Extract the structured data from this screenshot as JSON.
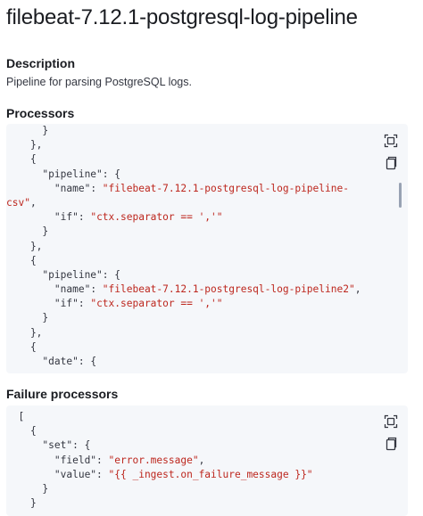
{
  "page": {
    "title": "filebeat-7.12.1-postgresql-log-pipeline"
  },
  "description": {
    "heading": "Description",
    "text": "Pipeline for parsing PostgreSQL logs."
  },
  "processors": {
    "heading": "Processors",
    "lines": [
      [
        {
          "t": "p",
          "v": "      }"
        }
      ],
      [
        {
          "t": "p",
          "v": "    },"
        }
      ],
      [
        {
          "t": "p",
          "v": "    {"
        }
      ],
      [
        {
          "t": "p",
          "v": "      "
        },
        {
          "t": "k",
          "v": "\"pipeline\""
        },
        {
          "t": "p",
          "v": ": {"
        }
      ],
      [
        {
          "t": "p",
          "v": "        "
        },
        {
          "t": "k",
          "v": "\"name\""
        },
        {
          "t": "p",
          "v": ": "
        },
        {
          "t": "s",
          "v": "\"filebeat-7.12.1-postgresql-log-pipeline-"
        }
      ],
      [
        {
          "t": "s",
          "v": "csv\""
        },
        {
          "t": "p",
          "v": ","
        }
      ],
      [
        {
          "t": "p",
          "v": "        "
        },
        {
          "t": "k",
          "v": "\"if\""
        },
        {
          "t": "p",
          "v": ": "
        },
        {
          "t": "s",
          "v": "\"ctx.separator == ','\""
        }
      ],
      [
        {
          "t": "p",
          "v": "      }"
        }
      ],
      [
        {
          "t": "p",
          "v": "    },"
        }
      ],
      [
        {
          "t": "p",
          "v": "    {"
        }
      ],
      [
        {
          "t": "p",
          "v": "      "
        },
        {
          "t": "k",
          "v": "\"pipeline\""
        },
        {
          "t": "p",
          "v": ": {"
        }
      ],
      [
        {
          "t": "p",
          "v": "        "
        },
        {
          "t": "k",
          "v": "\"name\""
        },
        {
          "t": "p",
          "v": ": "
        },
        {
          "t": "s",
          "v": "\"filebeat-7.12.1-postgresql-log-pipeline2\""
        },
        {
          "t": "p",
          "v": ","
        }
      ],
      [
        {
          "t": "p",
          "v": "        "
        },
        {
          "t": "k",
          "v": "\"if\""
        },
        {
          "t": "p",
          "v": ": "
        },
        {
          "t": "s",
          "v": "\"ctx.separator == ','\""
        }
      ],
      [
        {
          "t": "p",
          "v": "      }"
        }
      ],
      [
        {
          "t": "p",
          "v": "    },"
        }
      ],
      [
        {
          "t": "p",
          "v": "    {"
        }
      ],
      [
        {
          "t": "p",
          "v": "      "
        },
        {
          "t": "k",
          "v": "\"date\""
        },
        {
          "t": "p",
          "v": ": {"
        }
      ]
    ]
  },
  "failure_processors": {
    "heading": "Failure processors",
    "lines": [
      [
        {
          "t": "p",
          "v": "  ["
        }
      ],
      [
        {
          "t": "p",
          "v": "    {"
        }
      ],
      [
        {
          "t": "p",
          "v": "      "
        },
        {
          "t": "k",
          "v": "\"set\""
        },
        {
          "t": "p",
          "v": ": {"
        }
      ],
      [
        {
          "t": "p",
          "v": "        "
        },
        {
          "t": "k",
          "v": "\"field\""
        },
        {
          "t": "p",
          "v": ": "
        },
        {
          "t": "s",
          "v": "\"error.message\""
        },
        {
          "t": "p",
          "v": ","
        }
      ],
      [
        {
          "t": "p",
          "v": "        "
        },
        {
          "t": "k",
          "v": "\"value\""
        },
        {
          "t": "p",
          "v": ": "
        },
        {
          "t": "s",
          "v": "\"{{ _ingest.on_failure_message }}\""
        }
      ],
      [
        {
          "t": "p",
          "v": "      }"
        }
      ],
      [
        {
          "t": "p",
          "v": "    }"
        }
      ]
    ]
  },
  "icons": {
    "fullscreen": "fullscreen-icon",
    "copy": "copy-icon"
  },
  "colors": {
    "code_background": "#f5f7fa",
    "string": "#bd271e",
    "text": "#343741",
    "heading": "#1a1c21"
  }
}
